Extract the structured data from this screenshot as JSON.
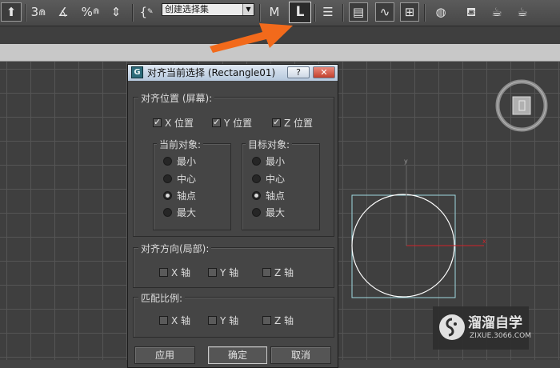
{
  "toolbar": {
    "icons": [
      "3",
      "%",
      "{",
      "M",
      "L"
    ],
    "selection_set": "创建选择集",
    "dropdown_arrow": "▼"
  },
  "dialog": {
    "title": "对齐当前选择 (Rectangle01)",
    "help_label": "?",
    "close_label": "✕",
    "align_position": {
      "label": "对齐位置 (屏幕):",
      "x": {
        "label": "X 位置",
        "checked": true
      },
      "y": {
        "label": "Y 位置",
        "checked": true
      },
      "z": {
        "label": "Z 位置",
        "checked": true
      }
    },
    "current_object": {
      "label": "当前对象:",
      "options": [
        "最小",
        "中心",
        "轴点",
        "最大"
      ],
      "selected": "轴点"
    },
    "target_object": {
      "label": "目标对象:",
      "options": [
        "最小",
        "中心",
        "轴点",
        "最大"
      ],
      "selected": "轴点"
    },
    "align_orientation": {
      "label": "对齐方向(局部):",
      "x": "X 轴",
      "y": "Y 轴",
      "z": "Z 轴"
    },
    "match_scale": {
      "label": "匹配比例:",
      "x": "X 轴",
      "y": "Y 轴",
      "z": "Z 轴"
    },
    "buttons": {
      "apply": "应用",
      "ok": "确定",
      "cancel": "取消"
    }
  },
  "viewport": {
    "axis_y": "y",
    "axis_x": "x"
  },
  "watermark": {
    "title": "溜溜自学",
    "url": "ZIXUE.3066.COM"
  },
  "colors": {
    "arrow": "#f26a1b",
    "circle": "#ffffff",
    "bbox": "#9fd8e0",
    "axis_x": "#d2232a"
  }
}
